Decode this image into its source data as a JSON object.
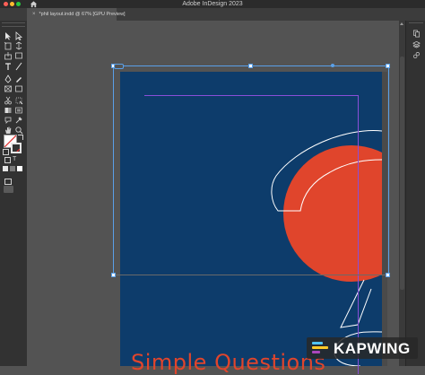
{
  "app": {
    "title": "Adobe InDesign 2023",
    "colors": {
      "close": "#ff5f57",
      "minimize": "#febc2e",
      "zoom": "#28c840"
    }
  },
  "tab": {
    "label": "*phil layout.indd @ 67% [GPU Preview]",
    "close_glyph": "×"
  },
  "tools": [
    "selection-tool",
    "direct-selection-tool",
    "page-tool",
    "gap-tool",
    "content-collector-tool",
    "content-placer-tool",
    "type-tool",
    "line-tool",
    "pen-tool",
    "pencil-tool",
    "rectangle-frame-tool",
    "rectangle-tool",
    "scissors-tool",
    "free-transform-tool",
    "gradient-swatch-tool",
    "gradient-feather-tool",
    "note-tool",
    "eyedropper-tool",
    "hand-tool",
    "zoom-tool"
  ],
  "right_panel": [
    "pages-icon",
    "layers-icon",
    "links-icon"
  ],
  "document": {
    "headline": "Simple Questions",
    "colors": {
      "page": "#0d3c6b",
      "circle": "#e0452c",
      "headline": "#e0452c",
      "margin": "#8a4fd8",
      "selection": "#5aa0e8"
    }
  },
  "watermark": {
    "text": "KAPWING"
  }
}
